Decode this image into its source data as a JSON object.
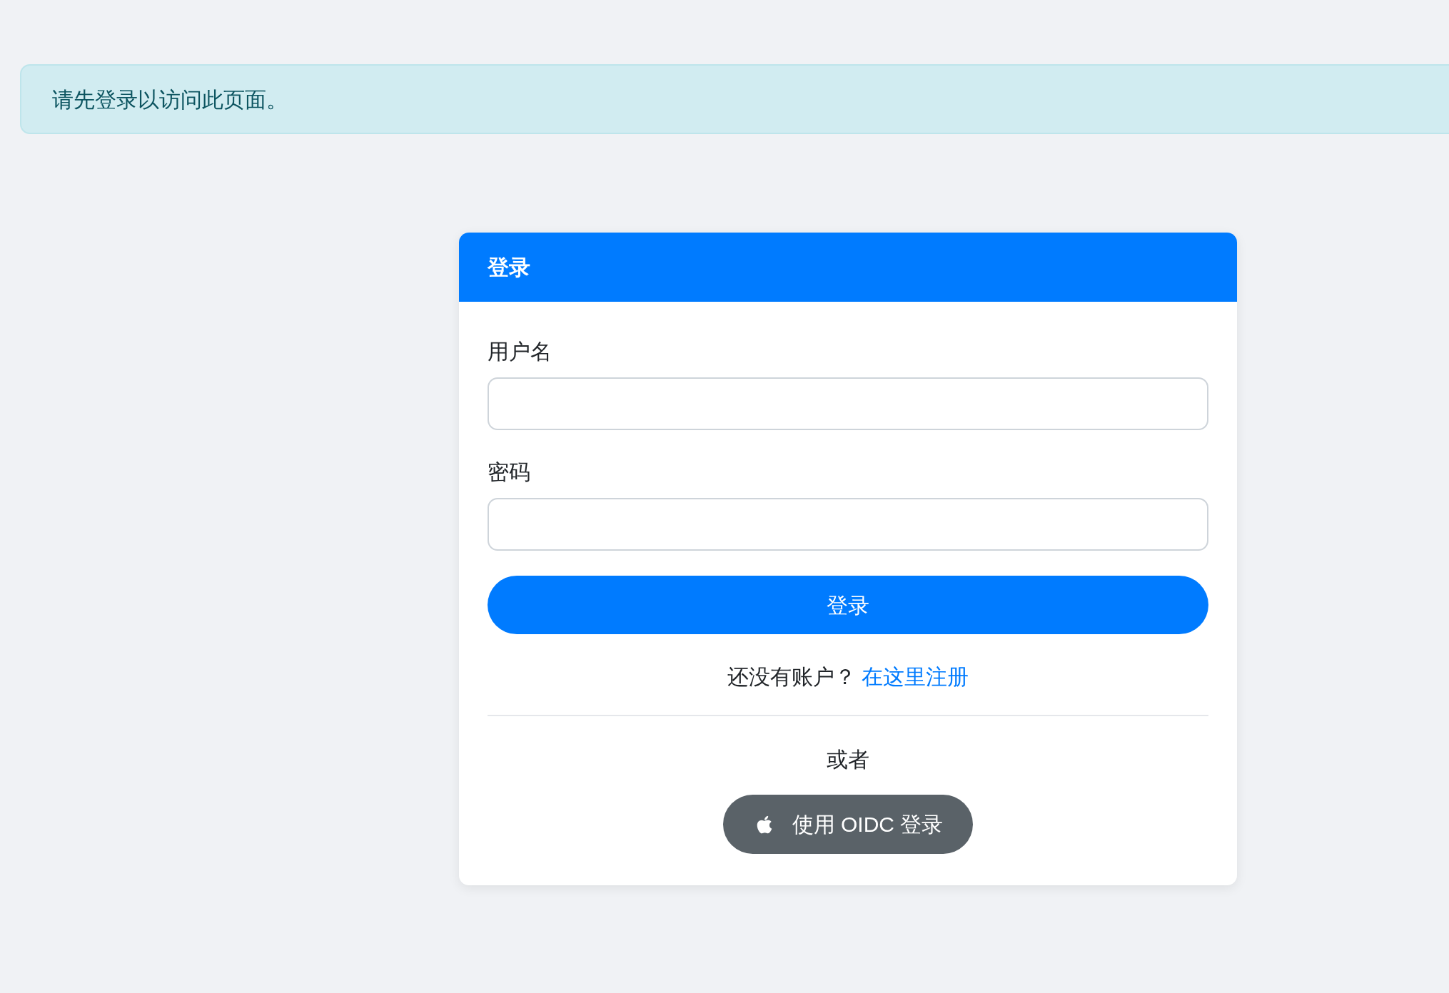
{
  "alert": {
    "text": "请先登录以访问此页面。"
  },
  "login_card": {
    "title": "登录",
    "fields": [
      {
        "label": "用户名"
      },
      {
        "label": "密码"
      }
    ],
    "submit_button": "登录",
    "register_prompt": {
      "text": "还没有账户？",
      "link": "在这里注册"
    },
    "divider_text": "或者",
    "oidc_button": {
      "label": "使用 OIDC 登录"
    }
  }
}
